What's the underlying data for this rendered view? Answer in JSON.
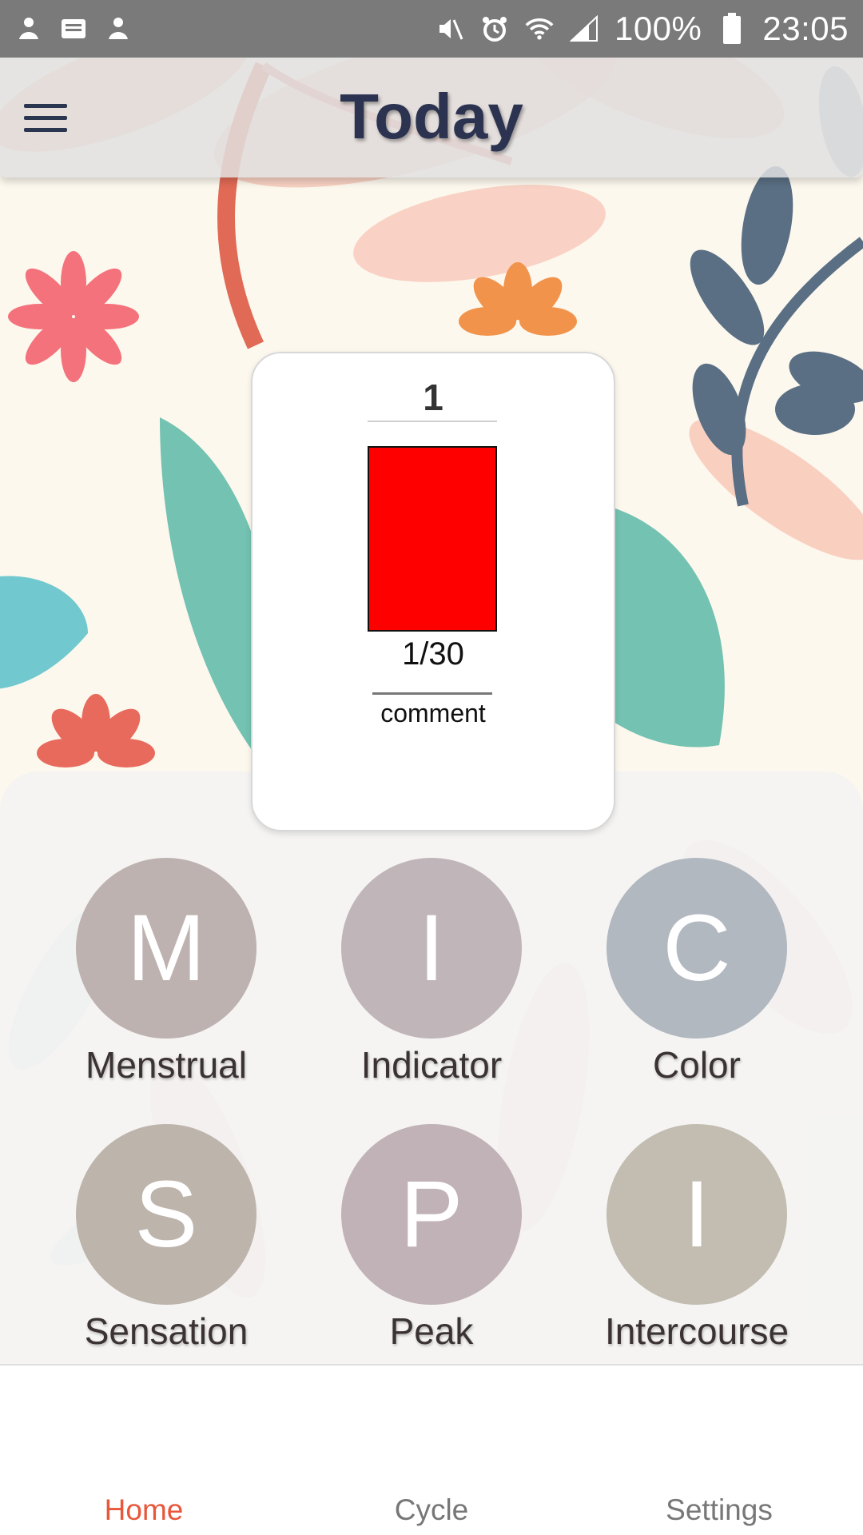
{
  "status_bar": {
    "battery_percent": "100%",
    "time": "23:05",
    "left_icons": [
      "notification-icon",
      "message-icon",
      "notification-icon"
    ],
    "right_icons": [
      "mute-icon",
      "alarm-icon",
      "wifi-icon",
      "signal-icon",
      "battery-icon"
    ]
  },
  "app_bar": {
    "title": "Today",
    "menu_icon": "hamburger-menu-icon"
  },
  "day_card": {
    "day_number": "1",
    "stamp_color": "#ff0000",
    "cycle_day": "1/30",
    "comment": "comment"
  },
  "options": [
    {
      "letter": "M",
      "label": "Menstrual",
      "color": "#bdb2b0"
    },
    {
      "letter": "I",
      "label": "Indicator",
      "color": "#c0b5b9"
    },
    {
      "letter": "C",
      "label": "Color",
      "color": "#b1b8c0"
    },
    {
      "letter": "S",
      "label": "Sensation",
      "color": "#bdb4ac"
    },
    {
      "letter": "P",
      "label": "Peak",
      "color": "#c0b2b6"
    },
    {
      "letter": "I",
      "label": "Intercourse",
      "color": "#c2bdb0"
    }
  ],
  "bottom_nav": {
    "items": [
      "Home",
      "Cycle",
      "Settings"
    ],
    "active": "Home",
    "active_color": "#e8573a"
  }
}
